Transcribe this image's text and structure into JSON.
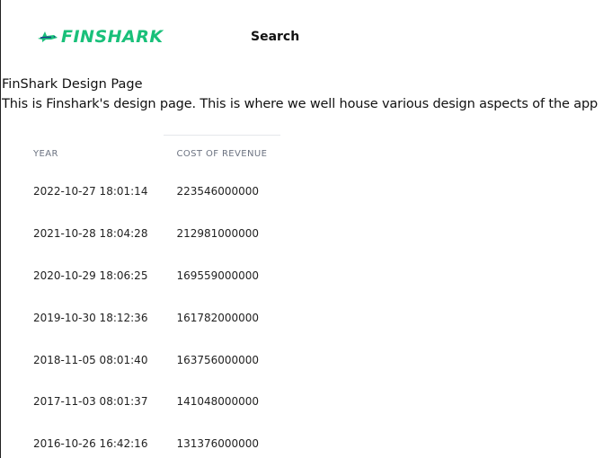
{
  "navbar": {
    "logo_text": "FINSHARK",
    "search_label": "Search",
    "brand_color": "#19c07a"
  },
  "page": {
    "title": "FinShark Design Page",
    "description": "This is Finshark's design page. This is where we well house various design aspects of the app"
  },
  "table": {
    "headers": [
      "YEAR",
      "COST OF REVENUE"
    ],
    "rows": [
      [
        "2022-10-27 18:01:14",
        "223546000000"
      ],
      [
        "2021-10-28 18:04:28",
        "212981000000"
      ],
      [
        "2020-10-29 18:06:25",
        "169559000000"
      ],
      [
        "2019-10-30 18:12:36",
        "161782000000"
      ],
      [
        "2018-11-05 08:01:40",
        "163756000000"
      ],
      [
        "2017-11-03 08:01:37",
        "141048000000"
      ],
      [
        "2016-10-26 16:42:16",
        "131376000000"
      ]
    ]
  }
}
